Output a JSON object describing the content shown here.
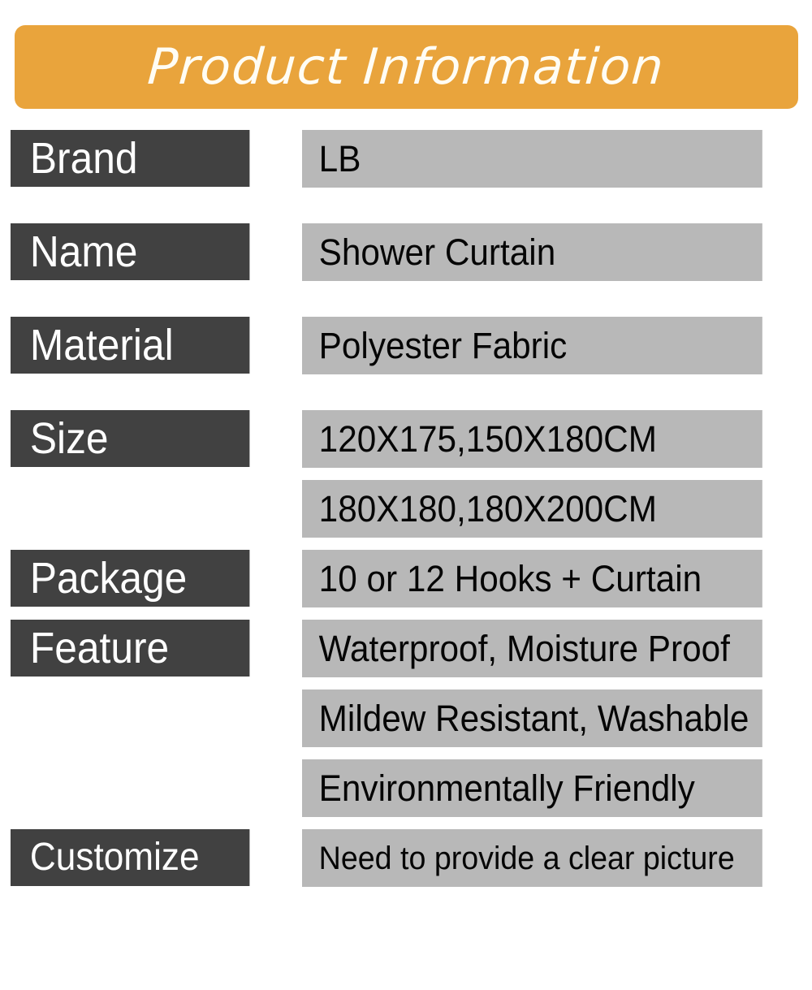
{
  "header": {
    "title": "Product Information",
    "background_color": "#e9a43c",
    "text_color": "#fffdf4"
  },
  "theme": {
    "label_background": "#414141",
    "label_text": "#ffffff",
    "value_background": "#b8b8b8",
    "value_text": "#050505",
    "page_background": "#ffffff"
  },
  "table": {
    "rows": [
      {
        "label": "Brand",
        "values": [
          "LB"
        ]
      },
      {
        "label": "Name",
        "values": [
          "Shower Curtain"
        ]
      },
      {
        "label": "Material",
        "values": [
          "Polyester Fabric"
        ]
      },
      {
        "label": "Size",
        "values": [
          "120X175,150X180CM",
          "180X180,180X200CM"
        ]
      },
      {
        "label": "Package",
        "values": [
          "10 or 12 Hooks + Curtain"
        ]
      },
      {
        "label": "Feature",
        "values": [
          "Waterproof, Moisture Proof",
          "Mildew Resistant, Washable",
          "Environmentally Friendly"
        ]
      },
      {
        "label": "Customize",
        "values": [
          "Need to provide a clear picture"
        ]
      }
    ]
  }
}
